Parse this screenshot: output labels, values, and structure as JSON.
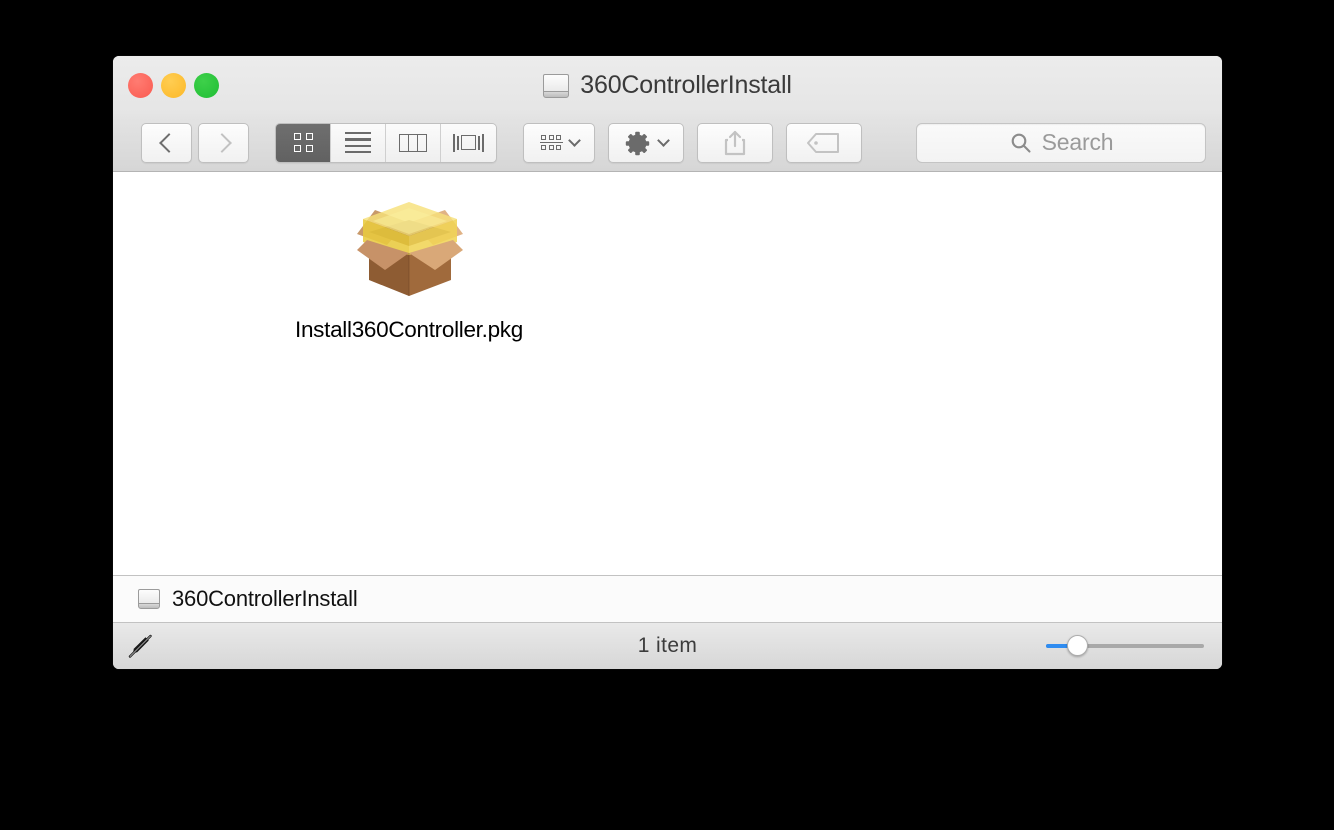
{
  "window": {
    "title": "360ControllerInstall",
    "title_icon": "disk-icon",
    "traffic_lights": {
      "close_color": "#fa5a50",
      "minimize_color": "#fcb827",
      "maximize_color": "#1fbe34"
    }
  },
  "toolbar": {
    "back_label": "Back",
    "forward_label": "Forward",
    "view_modes": [
      {
        "name": "icon-view",
        "label": "Icon View",
        "selected": true
      },
      {
        "name": "list-view",
        "label": "List View",
        "selected": false
      },
      {
        "name": "column-view",
        "label": "Column View",
        "selected": false
      },
      {
        "name": "coverflow-view",
        "label": "Cover Flow View",
        "selected": false
      }
    ],
    "arrange_label": "Arrange By",
    "action_label": "Action",
    "share_label": "Share",
    "tag_label": "Edit Tags",
    "selected_view_bg": "#6f6f6f"
  },
  "search": {
    "placeholder": "Search",
    "value": "",
    "icon": "search-icon"
  },
  "content": {
    "files": [
      {
        "name": "Install360Controller.pkg",
        "icon": "package-icon",
        "selected": false
      }
    ]
  },
  "pathbar": {
    "segments": [
      {
        "label": "360ControllerInstall",
        "icon": "disk-icon"
      }
    ]
  },
  "statusbar": {
    "readonly_icon": "pencil-slash-icon",
    "item_count_text": "1 item",
    "zoom_slider": {
      "value": 20,
      "min": 0,
      "max": 100,
      "fill_color": "#2f8cf0",
      "track_color": "#a9a9a9"
    }
  }
}
